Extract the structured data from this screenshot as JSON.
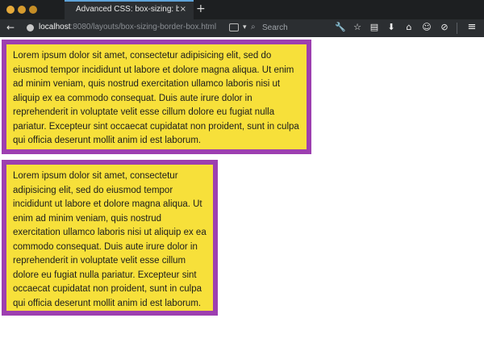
{
  "browser": {
    "tab": {
      "title": "Advanced CSS: box-sizing: bor...",
      "close_glyph": "×"
    },
    "new_tab_glyph": "+",
    "nav": {
      "back_glyph": "←",
      "url_host": "localhost",
      "url_rest": ":8080/layouts/box-sizing-border-box.html",
      "search_placeholder": "Search"
    },
    "toolbar": {
      "icons": [
        "wrench-icon",
        "star-icon",
        "clipboard-icon",
        "download-icon",
        "home-icon",
        "smiley-icon",
        "block-icon",
        "menu-icon"
      ],
      "glyphs": {
        "wrench": "🔧",
        "star": "☆",
        "clipboard": "▤",
        "download": "⬇",
        "home": "⌂",
        "smile": "☺",
        "block": "⊘",
        "menu": "≡"
      }
    }
  },
  "page": {
    "box1_text": "Lorem ipsum dolor sit amet, consectetur adipisicing elit, sed do eiusmod tempor incididunt ut labore et dolore magna aliqua. Ut enim ad minim veniam, quis nostrud exercitation ullamco laboris nisi ut aliquip ex ea commodo consequat. Duis aute irure dolor in reprehenderit in voluptate velit esse cillum dolore eu fugiat nulla pariatur. Excepteur sint occaecat cupidatat non proident, sunt in culpa qui officia deserunt mollit anim id est laborum.",
    "box2_text": "Lorem ipsum dolor sit amet, consectetur adipisicing elit, sed do eiusmod tempor incididunt ut labore et dolore magna aliqua. Ut enim ad minim veniam, quis nostrud exercitation ullamco laboris nisi ut aliquip ex ea commodo consequat. Duis aute irure dolor in reprehenderit in voluptate velit esse cillum dolore eu fugiat nulla pariatur. Excepteur sint occaecat cupidatat non proident, sunt in culpa qui officia deserunt mollit anim id est laborum."
  },
  "colors": {
    "box_background": "#f7e03a",
    "box_border": "#9d3fb0",
    "chrome_dark": "#2b2e31",
    "tab_accent": "#5fa3d9"
  }
}
